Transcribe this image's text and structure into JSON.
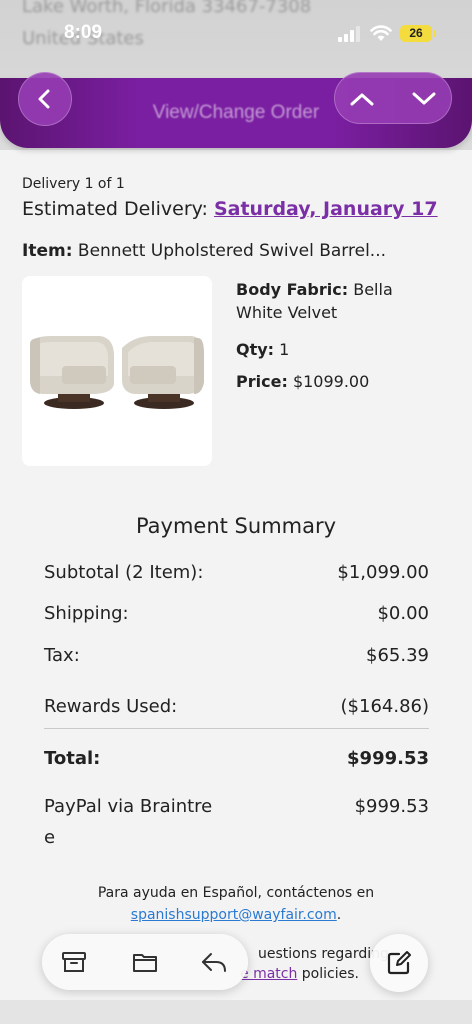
{
  "status_bar": {
    "time": "8:09",
    "battery": "26"
  },
  "background_address": {
    "line1": "Lake Worth, Florida 33467-7308",
    "line2": "United States"
  },
  "nav": {
    "title": "View/Change Order"
  },
  "delivery": {
    "count": "Delivery 1 of 1",
    "estimated_label": "Estimated Delivery:",
    "estimated_date": "Saturday, January 17"
  },
  "item": {
    "label": "Item:",
    "name": "Bennett Upholstered Swivel Barrel...",
    "body_fabric_label": "Body Fabric:",
    "body_fabric_line1": "Bella",
    "body_fabric_line2": "White Velvet",
    "qty_label": "Qty:",
    "qty": "1",
    "price_label": "Price:",
    "price": "$1099.00"
  },
  "payment_summary": {
    "title": "Payment Summary",
    "rows": [
      {
        "label": "Subtotal (2 Item):",
        "value": "$1,099.00"
      },
      {
        "label": "Shipping:",
        "value": "$0.00"
      },
      {
        "label": "Tax:",
        "value": "$65.39"
      },
      {
        "label": "Rewards Used:",
        "value": "($164.86)"
      }
    ],
    "total_label": "Total:",
    "total_value": "$999.53",
    "payment_method_line1": "PayPal via Braintre",
    "payment_method_line2": "e",
    "payment_value": "$999.53"
  },
  "help": {
    "spanish_text": "Para ayuda en Español, contáctenos en",
    "spanish_email": "spanishsupport@wayfair.com",
    "spanish_period": ".",
    "questions_text": "uestions regarding",
    "price_match_link": "e match",
    "policies_text": "policies."
  }
}
